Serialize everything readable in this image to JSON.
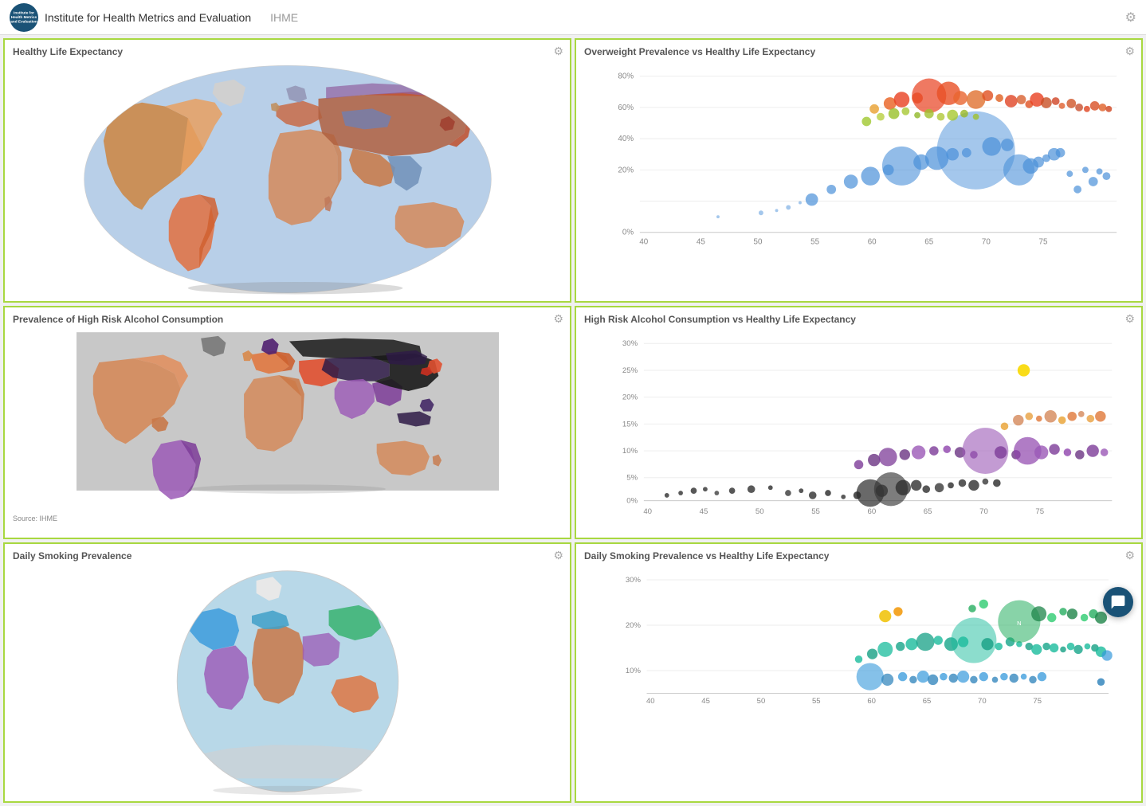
{
  "header": {
    "org_name": "Institute for Health Metrics and Evaluation",
    "abbr": "IHME",
    "gear_icon": "⚙"
  },
  "panels": [
    {
      "id": "healthy-life-expectancy-map",
      "title": "Healthy Life Expectancy",
      "type": "map",
      "map_style": "oval"
    },
    {
      "id": "overweight-scatter",
      "title": "Overweight Prevalence vs Healthy Life Expectancy",
      "type": "scatter",
      "y_labels": [
        "80%",
        "60%",
        "40%",
        "20%",
        "0%"
      ],
      "x_labels": [
        "40",
        "45",
        "50",
        "55",
        "60",
        "65",
        "70",
        "75"
      ]
    },
    {
      "id": "alcohol-map",
      "title": "Prevalence of High Risk Alcohol Consumption",
      "type": "map",
      "map_style": "rectangular",
      "source": "Source: IHME"
    },
    {
      "id": "alcohol-scatter",
      "title": "High Risk Alcohol Consumption vs Healthy Life Expectancy",
      "type": "scatter",
      "y_labels": [
        "30%",
        "25%",
        "20%",
        "15%",
        "10%",
        "5%",
        "0%"
      ],
      "x_labels": [
        "40",
        "45",
        "50",
        "55",
        "60",
        "65",
        "70",
        "75"
      ]
    },
    {
      "id": "smoking-map",
      "title": "Daily Smoking Prevalence",
      "type": "map",
      "map_style": "globe"
    },
    {
      "id": "smoking-scatter",
      "title": "Daily Smoking Prevalence vs Healthy Life Expectancy",
      "type": "scatter",
      "y_labels": [
        "30%",
        "20%",
        "10%"
      ],
      "x_labels": [
        "40",
        "45",
        "50",
        "55",
        "60",
        "65",
        "70",
        "75"
      ]
    }
  ],
  "gear_icon": "⚙",
  "chat_icon": "💬"
}
